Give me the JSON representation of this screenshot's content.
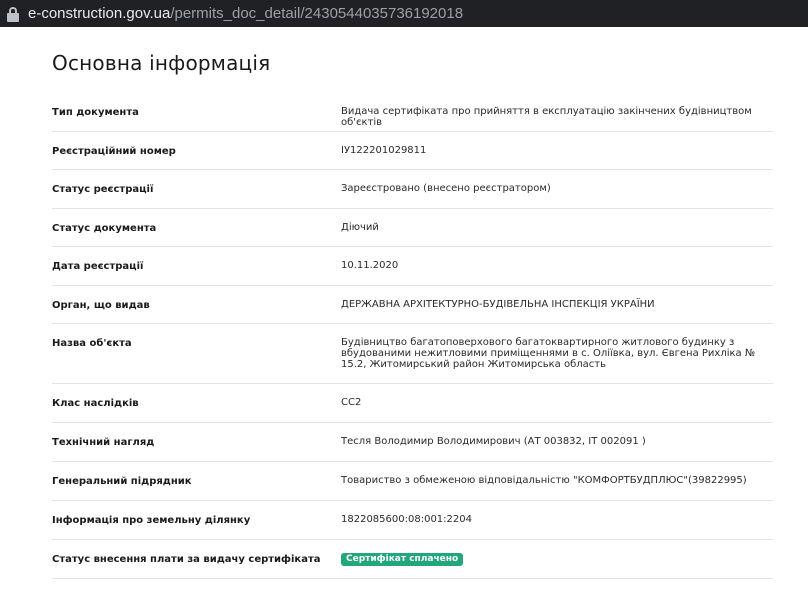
{
  "browser": {
    "url_host": "e-construction.gov.ua",
    "url_path": "/permits_doc_detail/2430544035736192018"
  },
  "page": {
    "title": "Основна інформація"
  },
  "rows": [
    {
      "label": "Тип документа",
      "value": "Видача сертифіката про прийняття в експлуатацію закінчених будівництвом об'єктів"
    },
    {
      "label": "Реєстраційний номер",
      "value": "ІУ122201029811"
    },
    {
      "label": "Статус реєстрації",
      "value": "Зареєстровано (внесено реєстратором)"
    },
    {
      "label": "Статус документа",
      "value": "Діючий"
    },
    {
      "label": "Дата реєстрації",
      "value": "10.11.2020"
    },
    {
      "label": "Орган, що видав",
      "value": "ДЕРЖАВНА АРХІТЕКТУРНО-БУДІВЕЛЬНА ІНСПЕКЦІЯ УКРАЇНИ"
    },
    {
      "label": "Назва об'єкта",
      "value": "Будівництво багатоповерхового багатоквартирного житлового будинку з вбудованими нежитловими приміщеннями в с. Оліївка, вул. Євгена Рихліка № 15.2, Житомирський район Житомирська область"
    },
    {
      "label": "Клас наслідків",
      "value": "СС2"
    },
    {
      "label": "Технічний нагляд",
      "value": "Тесля Володимир Володимирович (АТ 003832, ІТ 002091 )"
    },
    {
      "label": "Генеральний підрядник",
      "value": "Товариство з обмеженою відповідальністю \"КОМФОРТБУДПЛЮС\"(39822995)"
    },
    {
      "label": "Інформація про земельну ділянку",
      "value": "1822085600:08:001:2204"
    },
    {
      "label": "Статус внесення плати за видачу сертифіката",
      "badge": "Сертифікат сплачено"
    }
  ],
  "colors": {
    "badge_bg": "#22a77c",
    "divider": "#e4e4e4"
  }
}
